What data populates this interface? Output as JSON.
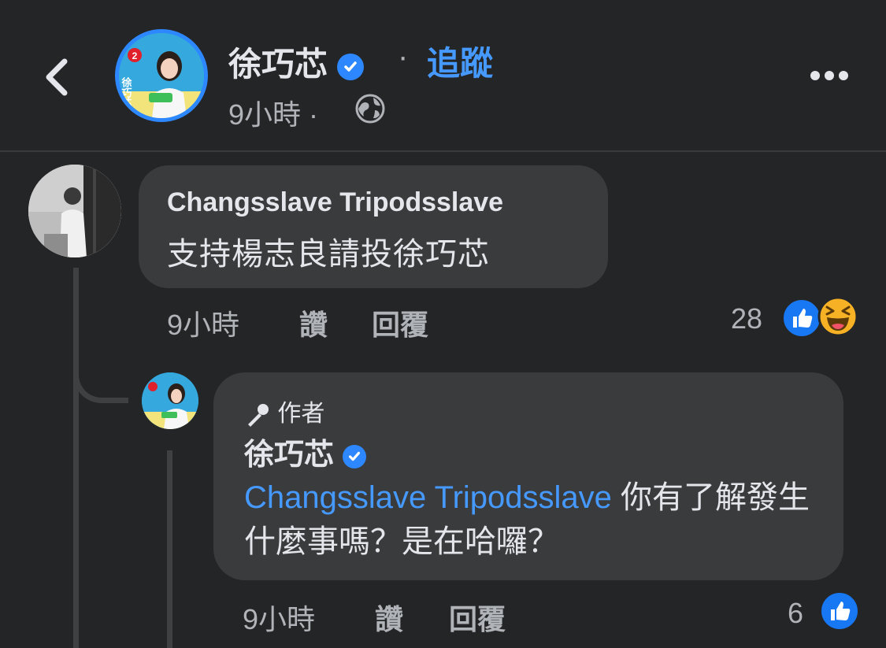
{
  "header": {
    "name": "徐巧芯",
    "dot": "·",
    "follow": "追蹤",
    "time": "9小時 ·",
    "privacy_icon": "globe-icon",
    "more_icon": "more-icon"
  },
  "avatar_poster": {
    "number": "2",
    "name": "徐巧芯"
  },
  "comment": {
    "author": "Changsslave Tripodsslave",
    "text": "支持楊志良請投徐巧芯",
    "time": "9小時",
    "like_label": "讚",
    "reply_label": "回覆",
    "reaction_count": "28"
  },
  "reply": {
    "badge": "作者",
    "author": "徐巧芯",
    "mention": "Changsslave Tripodsslave",
    "text": " 你有了解發生什麼事嗎？是在哈囉？",
    "time": "9小時",
    "like_label": "讚",
    "reply_label": "回覆",
    "reaction_count": "6"
  },
  "colors": {
    "background": "#242526",
    "bubble": "#3a3b3c",
    "accent": "#2d88ff",
    "link": "#4599ff",
    "text": "#e4e6eb",
    "muted": "#b0b3b8"
  }
}
